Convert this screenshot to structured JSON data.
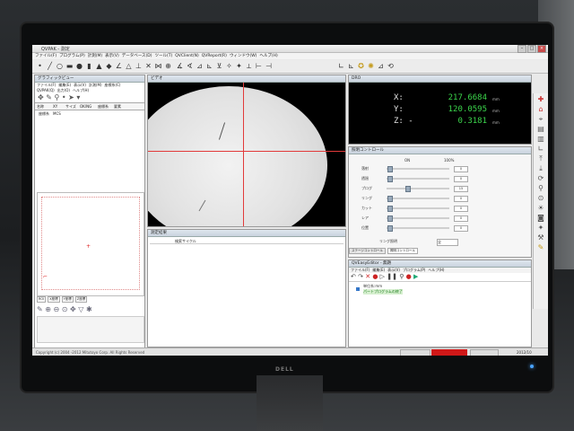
{
  "app": {
    "title": "QVPAK - 測定",
    "menu": [
      "ファイル(F)",
      "プログラム(P)",
      "計測(M)",
      "表示(V)",
      "データベース(D)",
      "ツール(T)",
      "QVClient(N)",
      "QVReport(R)",
      "ウィンドウ(W)",
      "ヘルプ(H)"
    ]
  },
  "graphics_view": {
    "title": "グラフィックビュー",
    "menu": [
      "ファイル(F)",
      "編集(E)",
      "表示(V)",
      "計測(M)",
      "座標系(C)"
    ],
    "menu2": [
      "QVPAK(Q)",
      "出力(O)",
      "ヘルプ(H)"
    ],
    "columns": [
      "名称",
      "XY",
      "サイズ",
      "OK/NG",
      "座標系",
      "要素"
    ],
    "row0": "座標系　MCS",
    "footer_tabs": [
      "ROI",
      "X座標",
      "Y座標",
      "Z座標"
    ]
  },
  "video": {
    "title": "ビデオ"
  },
  "dro": {
    "title": "DRO",
    "x_label": "X:",
    "x_value": "217.6684",
    "x_unit": "mm",
    "y_label": "Y:",
    "y_value": "120.0595",
    "y_unit": "mm",
    "z_label": "Z: -",
    "z_value": "0.3181",
    "z_unit": "mm"
  },
  "lighting": {
    "title": "照明コントロール",
    "col_on": "ON",
    "col_val": "100%",
    "rows": [
      {
        "label": "落射",
        "value": "0",
        "level": 0.02
      },
      {
        "label": "透過",
        "value": "0",
        "level": 0.02
      },
      {
        "label": "プログ",
        "value": "15",
        "level": 0.3
      },
      {
        "label": "リング",
        "value": "0",
        "level": 0.02
      },
      {
        "label": "カット",
        "value": "0",
        "level": 0.02
      },
      {
        "label": "レア",
        "value": "0",
        "level": 0.02
      },
      {
        "label": "位置",
        "value": "0",
        "level": 0.02
      }
    ],
    "ring_label": "リング照明",
    "ring_value": "全",
    "tabs": [
      "ステージコントロール",
      "照明コントロール"
    ]
  },
  "result_view": {
    "title": "測定結果",
    "field": "検索サイクル"
  },
  "part_program": {
    "title": "QVEasyEditor - 無題",
    "menu": [
      "ファイル(F)",
      "編集(E)",
      "表示(V)",
      "プログラム(P)",
      "ヘルプ(H)"
    ],
    "line1": "単位系:mm",
    "line2": "パートプログラムの終了"
  },
  "status": {
    "left": "Copyright (c) 2004 -2012  Mitutoyo Corp. All Rights Reserved",
    "right": "2012/10"
  }
}
